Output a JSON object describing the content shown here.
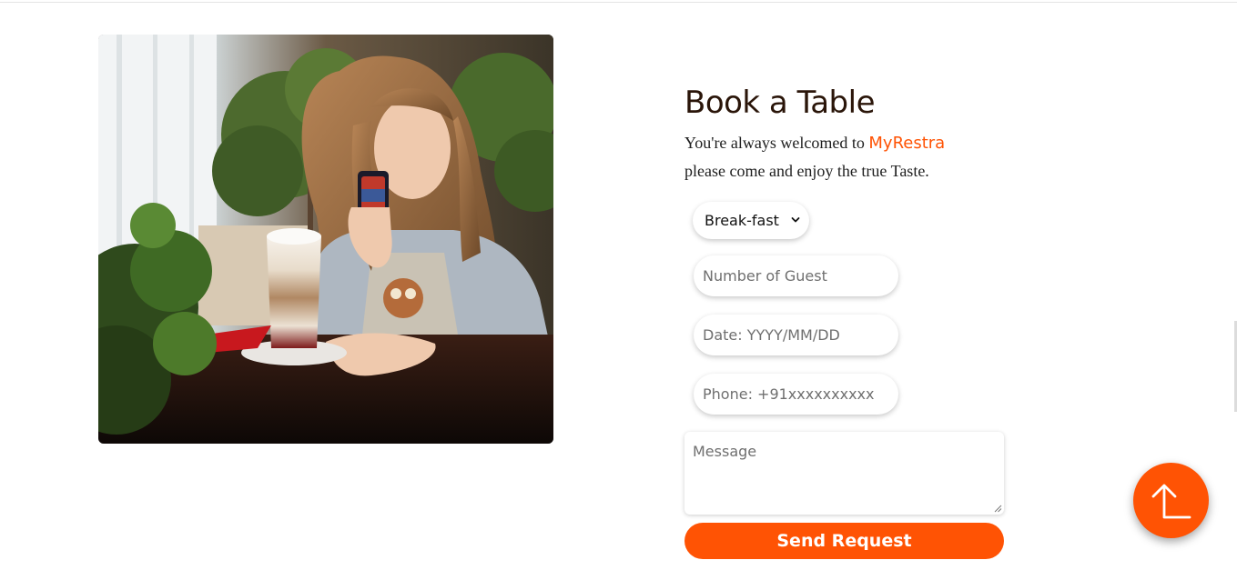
{
  "booking": {
    "title": "Book a Table",
    "intro_prefix": "You're always welcomed to ",
    "brand_name": "MyRestra",
    "intro_suffix": "please come and enjoy the true Taste.",
    "meal_select": {
      "selected": "Break-fast"
    },
    "guests_placeholder": "Number of Guest",
    "date_placeholder": "Date: YYYY/MM/DD",
    "phone_placeholder": "Phone: +91xxxxxxxxxx",
    "message_placeholder": "Message",
    "send_label": "Send Request"
  },
  "icons": {
    "meal_select_arrow": "chevron-down-icon",
    "scroll_top": "arrow-up-icon"
  },
  "colors": {
    "accent": "#ff5304",
    "title": "#2a1509",
    "text": "#1e1e1e",
    "placeholder": "#6f6f6f"
  }
}
